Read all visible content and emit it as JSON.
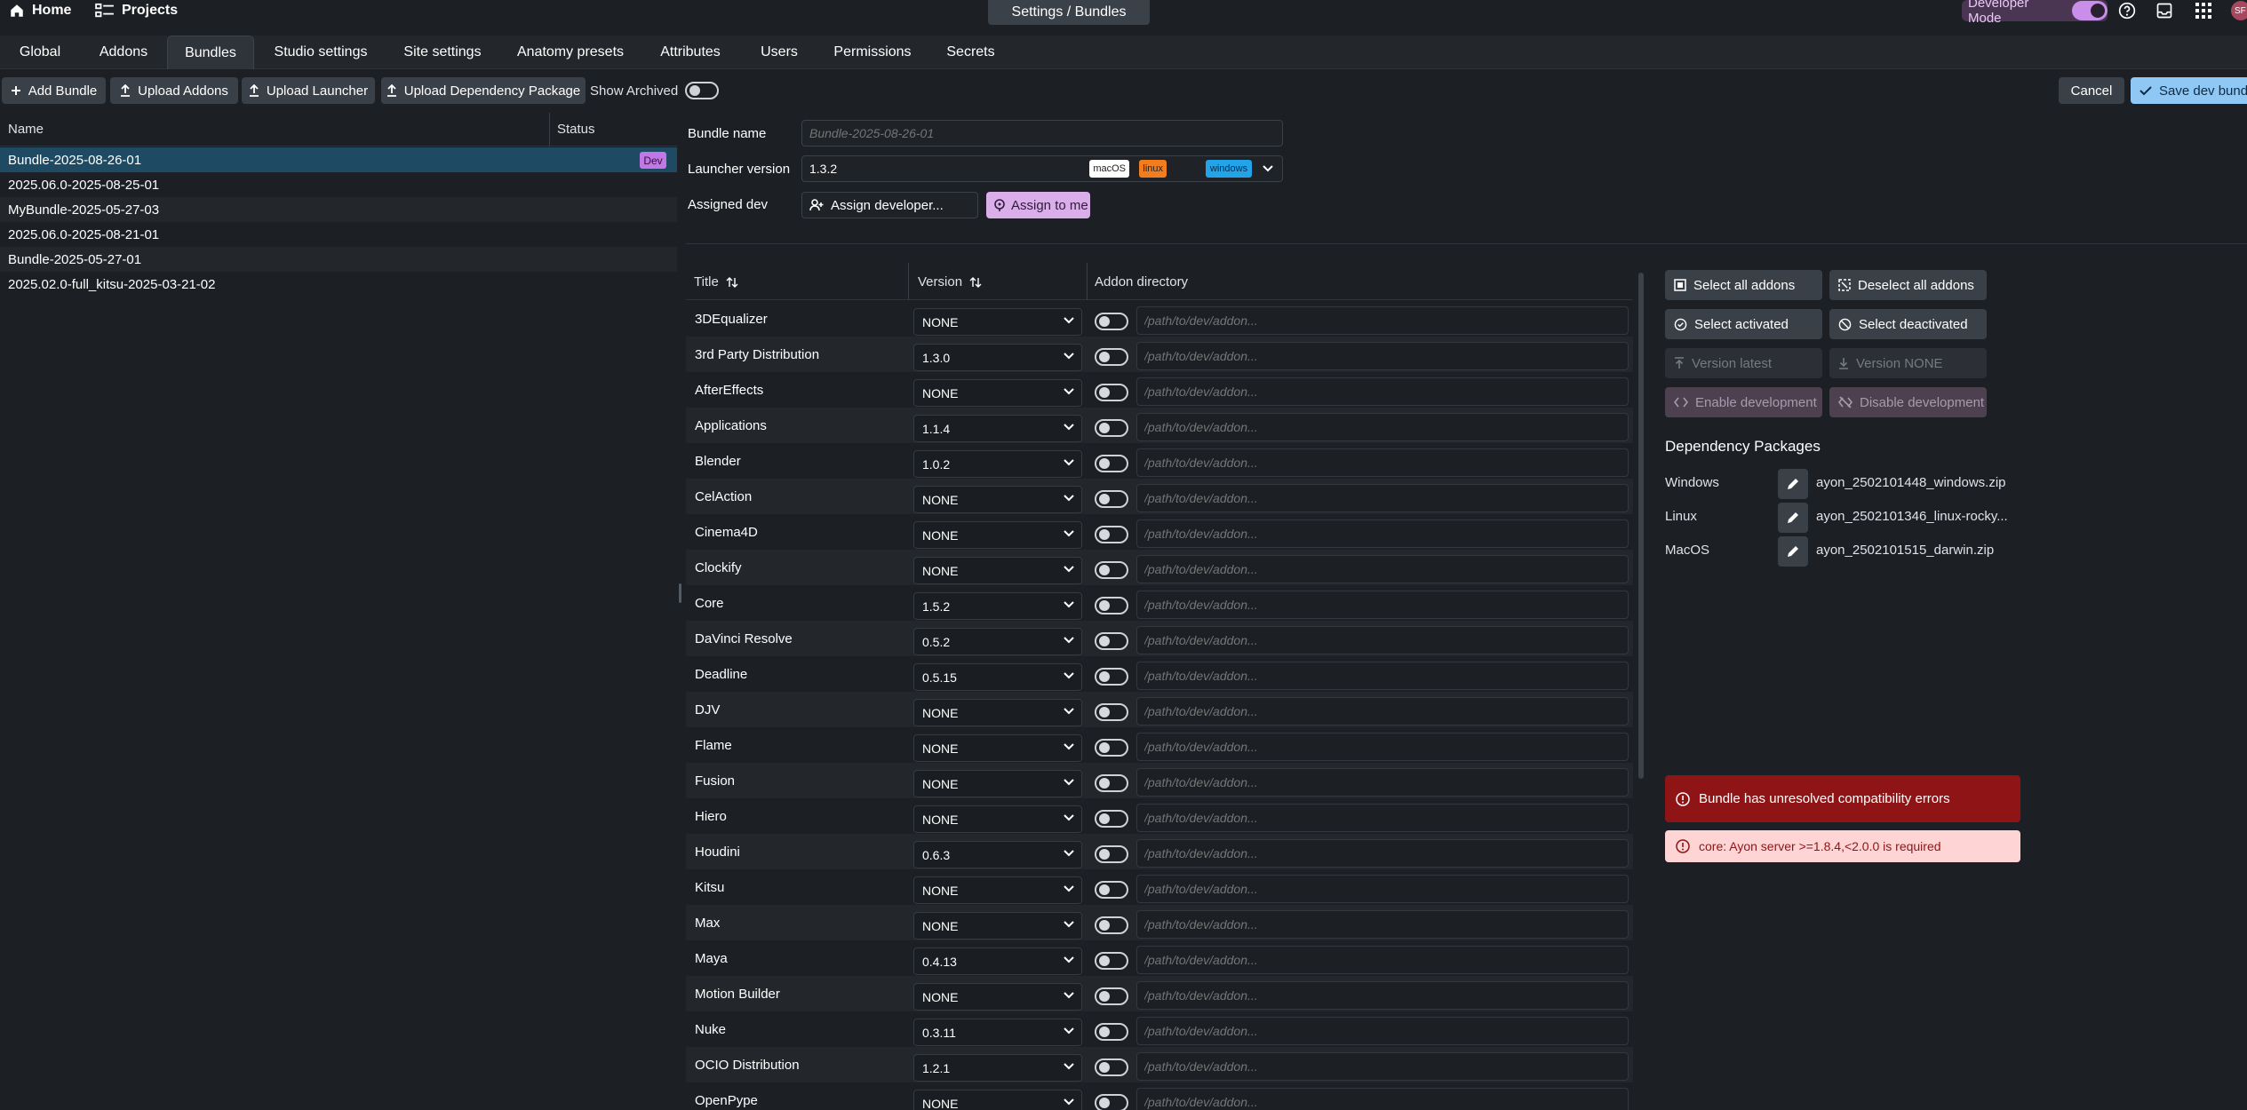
{
  "topbar": {
    "home_label": "Home",
    "projects_label": "Projects",
    "title": "Settings / Bundles",
    "developer_mode_label": "Developer Mode",
    "developer_mode_on": true,
    "avatar_initials": "SF"
  },
  "tabs": [
    "Global",
    "Addons",
    "Bundles",
    "Studio settings",
    "Site settings",
    "Anatomy presets",
    "Attributes",
    "Users",
    "Permissions",
    "Secrets"
  ],
  "active_tab": "Bundles",
  "toolbar": {
    "add_bundle": "Add Bundle",
    "upload_addons": "Upload Addons",
    "upload_launcher": "Upload Launcher",
    "upload_dependency": "Upload Dependency Package",
    "show_archived": "Show Archived",
    "cancel": "Cancel",
    "save": "Save dev bundle"
  },
  "bundle_list": {
    "col_name": "Name",
    "col_status": "Status",
    "rows": [
      {
        "name": "Bundle-2025-08-26-01",
        "status": "Dev"
      },
      {
        "name": "2025.06.0-2025-08-25-01",
        "status": ""
      },
      {
        "name": "MyBundle-2025-05-27-03",
        "status": ""
      },
      {
        "name": "2025.06.0-2025-08-21-01",
        "status": ""
      },
      {
        "name": "Bundle-2025-05-27-01",
        "status": ""
      },
      {
        "name": "2025.02.0-full_kitsu-2025-03-21-02",
        "status": ""
      }
    ]
  },
  "form": {
    "bundle_name_label": "Bundle name",
    "bundle_name_placeholder": "Bundle-2025-08-26-01",
    "launcher_label": "Launcher version",
    "launcher_value": "1.3.2",
    "platforms": [
      "macOS",
      "linux",
      "windows"
    ],
    "assigned_dev_label": "Assigned dev",
    "assign_developer": "Assign developer...",
    "assign_to_me": "Assign to me"
  },
  "addon_table": {
    "col_title": "Title",
    "col_version": "Version",
    "col_directory": "Addon directory",
    "path_placeholder": "/path/to/dev/addon...",
    "rows": [
      {
        "title": "3DEqualizer",
        "version": "NONE"
      },
      {
        "title": "3rd Party Distribution",
        "version": "1.3.0"
      },
      {
        "title": "AfterEffects",
        "version": "NONE"
      },
      {
        "title": "Applications",
        "version": "1.1.4"
      },
      {
        "title": "Blender",
        "version": "1.0.2"
      },
      {
        "title": "CelAction",
        "version": "NONE"
      },
      {
        "title": "Cinema4D",
        "version": "NONE"
      },
      {
        "title": "Clockify",
        "version": "NONE"
      },
      {
        "title": "Core",
        "version": "1.5.2"
      },
      {
        "title": "DaVinci Resolve",
        "version": "0.5.2"
      },
      {
        "title": "Deadline",
        "version": "0.5.15"
      },
      {
        "title": "DJV",
        "version": "NONE"
      },
      {
        "title": "Flame",
        "version": "NONE"
      },
      {
        "title": "Fusion",
        "version": "NONE"
      },
      {
        "title": "Hiero",
        "version": "NONE"
      },
      {
        "title": "Houdini",
        "version": "0.6.3"
      },
      {
        "title": "Kitsu",
        "version": "NONE"
      },
      {
        "title": "Max",
        "version": "NONE"
      },
      {
        "title": "Maya",
        "version": "0.4.13"
      },
      {
        "title": "Motion Builder",
        "version": "NONE"
      },
      {
        "title": "Nuke",
        "version": "0.3.11"
      },
      {
        "title": "OCIO Distribution",
        "version": "1.2.1"
      },
      {
        "title": "OpenPype",
        "version": "NONE"
      }
    ]
  },
  "actions": {
    "select_all": "Select all addons",
    "deselect_all": "Deselect all addons",
    "select_activated": "Select activated",
    "select_deactivated": "Select deactivated",
    "version_latest": "Version latest",
    "version_none": "Version NONE",
    "enable_dev": "Enable development",
    "disable_dev": "Disable development"
  },
  "dependency": {
    "title": "Dependency Packages",
    "rows": [
      {
        "os": "Windows",
        "file": "ayon_2502101448_windows.zip"
      },
      {
        "os": "Linux",
        "file": "ayon_2502101346_linux-rocky..."
      },
      {
        "os": "MacOS",
        "file": "ayon_2502101515_darwin.zip"
      }
    ]
  },
  "errors": {
    "main": "Bundle has unresolved compatibility errors",
    "detail": "core: Ayon server >=1.8.4,<2.0.0 is required"
  },
  "colors": {
    "accent": "#90c8f5",
    "selected_row": "#1f4a63",
    "dev_badge": "#c277e8",
    "error": "#8e1416",
    "error_light": "#ffd4d4"
  }
}
